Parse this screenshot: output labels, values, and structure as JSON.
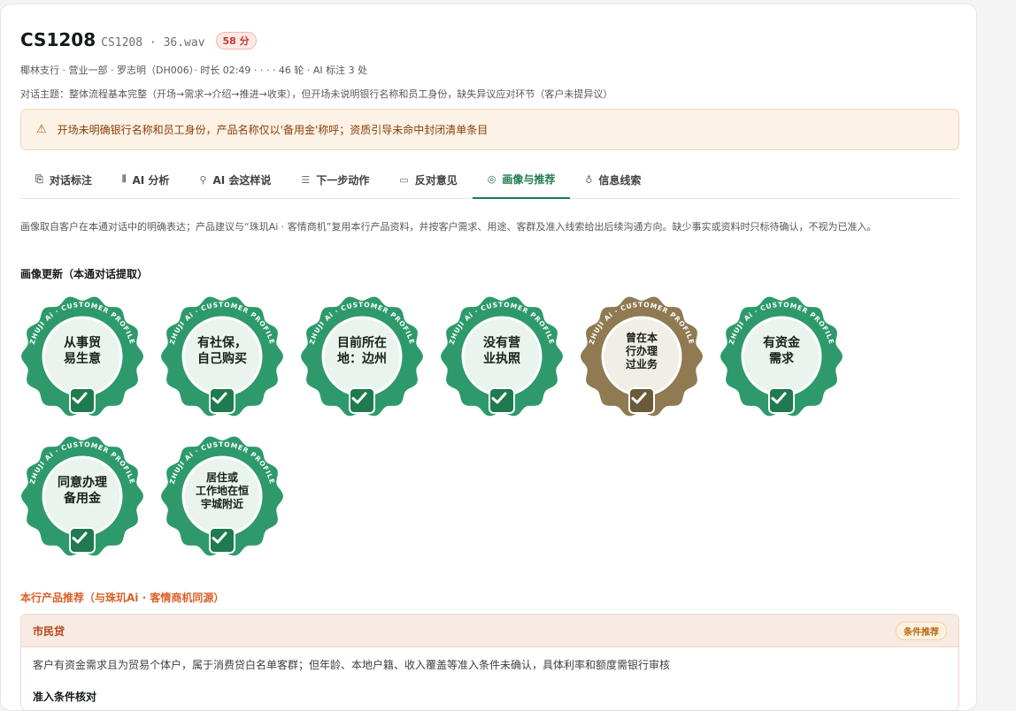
{
  "header": {
    "title": "CS1208",
    "subtitle": "CS1208 · 36.wav",
    "score": "58 分",
    "meta": "椰林支行 · 营业一部 · 罗志明（DH006）· 时长 02:49 · · · · 46 轮 · AI 标注 3 处",
    "topic": "对话主题：整体流程基本完整（开场→需求→介绍→推进→收束），但开场未说明银行名称和员工身份，缺失异议应对环节（客户未提异议）"
  },
  "alert": {
    "icon": "warning-icon",
    "text": "开场未明确银行名称和员工身份，产品名称仅以'备用金'称呼；资质引导未命中封闭清单条目"
  },
  "tabs": [
    {
      "label": "对话标注",
      "icon": "chat-icon",
      "glyph": "⎘",
      "active": false
    },
    {
      "label": "AI 分析",
      "icon": "bar-chart-icon",
      "glyph": "⫴",
      "active": false
    },
    {
      "label": "AI 会这样说",
      "icon": "magic-wand-icon",
      "glyph": "⚲",
      "active": false
    },
    {
      "label": "下一步动作",
      "icon": "checklist-icon",
      "glyph": "☰",
      "active": false
    },
    {
      "label": "反对意见",
      "icon": "message-icon",
      "glyph": "▭",
      "active": false
    },
    {
      "label": "画像与推荐",
      "icon": "target-icon",
      "glyph": "◎",
      "active": true
    },
    {
      "label": "信息线索",
      "icon": "lightbulb-icon",
      "glyph": "♁",
      "active": false
    }
  ],
  "intro": "画像取自客户在本通对话中的明确表达；产品建议与“珠玑Ai · 客情商机”复用本行产品资料，并按客户需求、用途、客群及准入线索给出后续沟通方向。缺少事实或资料时只标待确认，不视为已准入。",
  "profile_title": "画像更新（本通对话提取）",
  "badge_ring_text": "ZHUJI Ai · CUSTOMER PROFILE",
  "colors": {
    "green": "#2e9a6c",
    "green_dark": "#1f7a4f",
    "olive": "#8f7a52",
    "olive_dark": "#6a5a3b"
  },
  "badges": [
    {
      "label": "从事贸易生意",
      "lines": [
        "从事贸",
        "易生意"
      ],
      "tone": "green",
      "small": false
    },
    {
      "label": "有社保，自己购买",
      "lines": [
        "有社保，",
        "自己购买"
      ],
      "tone": "green",
      "small": false
    },
    {
      "label": "目前所在地：边州",
      "lines": [
        "目前所在",
        "地：边州"
      ],
      "tone": "green",
      "small": false
    },
    {
      "label": "没有营业执照",
      "lines": [
        "没有营",
        "业执照"
      ],
      "tone": "green",
      "small": false
    },
    {
      "label": "曾在本行办理过业务",
      "lines": [
        "曾在本",
        "行办理",
        "过业务"
      ],
      "tone": "olive",
      "small": true
    },
    {
      "label": "有资金需求",
      "lines": [
        "有资金",
        "需求"
      ],
      "tone": "green",
      "small": false
    },
    {
      "label": "同意办理备用金",
      "lines": [
        "同意办理",
        "备用金"
      ],
      "tone": "green",
      "small": false
    },
    {
      "label": "居住或工作地在恒宇城附近",
      "lines": [
        "居住或",
        "工作地在恒",
        "宇城附近"
      ],
      "tone": "green",
      "small": true
    }
  ],
  "recommendations": {
    "title": "本行产品推荐（与珠玑Ai · 客情商机同源）",
    "products": [
      {
        "name": "市民贷",
        "tag": "条件推荐",
        "desc": "客户有资金需求且为贸易个体户，属于消费贷白名单客群；但年龄、本地户籍、收入覆盖等准入条件未确认，具体利率和额度需银行审核",
        "sub_title": "准入条件核对"
      }
    ]
  }
}
